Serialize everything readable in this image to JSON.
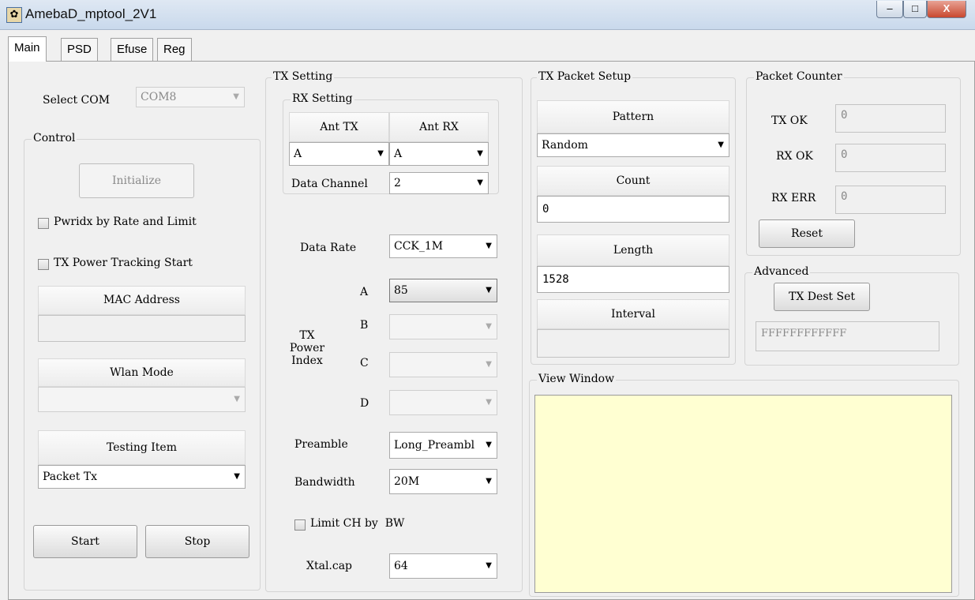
{
  "window": {
    "title": "AmebaD_mptool_2V1",
    "minimize": "–",
    "maximize": "□",
    "close": "X"
  },
  "tabs": [
    "Main",
    "PSD",
    "Efuse",
    "Reg"
  ],
  "select_com": {
    "label": "Select COM",
    "value": "COM8"
  },
  "control": {
    "legend": "Control",
    "initialize": "Initialize",
    "pwridx_checkbox": "Pwridx by Rate and Limit",
    "tracking_checkbox": "TX Power Tracking Start",
    "mac_address_label": "MAC Address",
    "mac_address_value": "",
    "wlan_mode_label": "Wlan Mode",
    "wlan_mode_value": "",
    "testing_item_label": "Testing Item",
    "testing_item_value": "Packet Tx",
    "start": "Start",
    "stop": "Stop"
  },
  "tx_setting": {
    "legend": "TX Setting",
    "rx_setting_legend": "RX Setting",
    "ant_tx_label": "Ant TX",
    "ant_rx_label": "Ant RX",
    "ant_tx_value": "A",
    "ant_rx_value": "A",
    "data_channel_label": "Data Channel",
    "data_channel_value": "2",
    "data_rate_label": "Data Rate",
    "data_rate_value": "CCK_1M",
    "tx_power_index_label": "TX Power Index",
    "power": [
      {
        "label": "A",
        "value": "85"
      },
      {
        "label": "B",
        "value": ""
      },
      {
        "label": "C",
        "value": ""
      },
      {
        "label": "D",
        "value": ""
      }
    ],
    "preamble_label": "Preamble",
    "preamble_value": "Long_Preambl",
    "bandwidth_label": "Bandwidth",
    "bandwidth_value": "20M",
    "limit_ch_checkbox": "Limit CH by  BW",
    "xtal_cap_label": "Xtal.cap",
    "xtal_cap_value": "64"
  },
  "tx_packet_setup": {
    "legend": "TX Packet Setup",
    "pattern_label": "Pattern",
    "pattern_value": "Random",
    "count_label": "Count",
    "count_value": "0",
    "length_label": "Length",
    "length_value": "1528",
    "interval_label": "Interval",
    "interval_value": ""
  },
  "packet_counter": {
    "legend": "Packet Counter",
    "tx_ok_label": "TX OK",
    "tx_ok_value": "0",
    "rx_ok_label": "RX OK",
    "rx_ok_value": "0",
    "rx_err_label": "RX ERR",
    "rx_err_value": "0",
    "reset": "Reset"
  },
  "advanced": {
    "legend": "Advanced",
    "tx_dest_set": "TX Dest Set",
    "dest_value": "FFFFFFFFFFFF"
  },
  "view_window": {
    "legend": "View Window",
    "content": ""
  },
  "colors": {
    "view_window_bg": "#ffffd2",
    "panel_bg": "#f0f0f0"
  },
  "icons": {
    "dropdown": "▼"
  }
}
